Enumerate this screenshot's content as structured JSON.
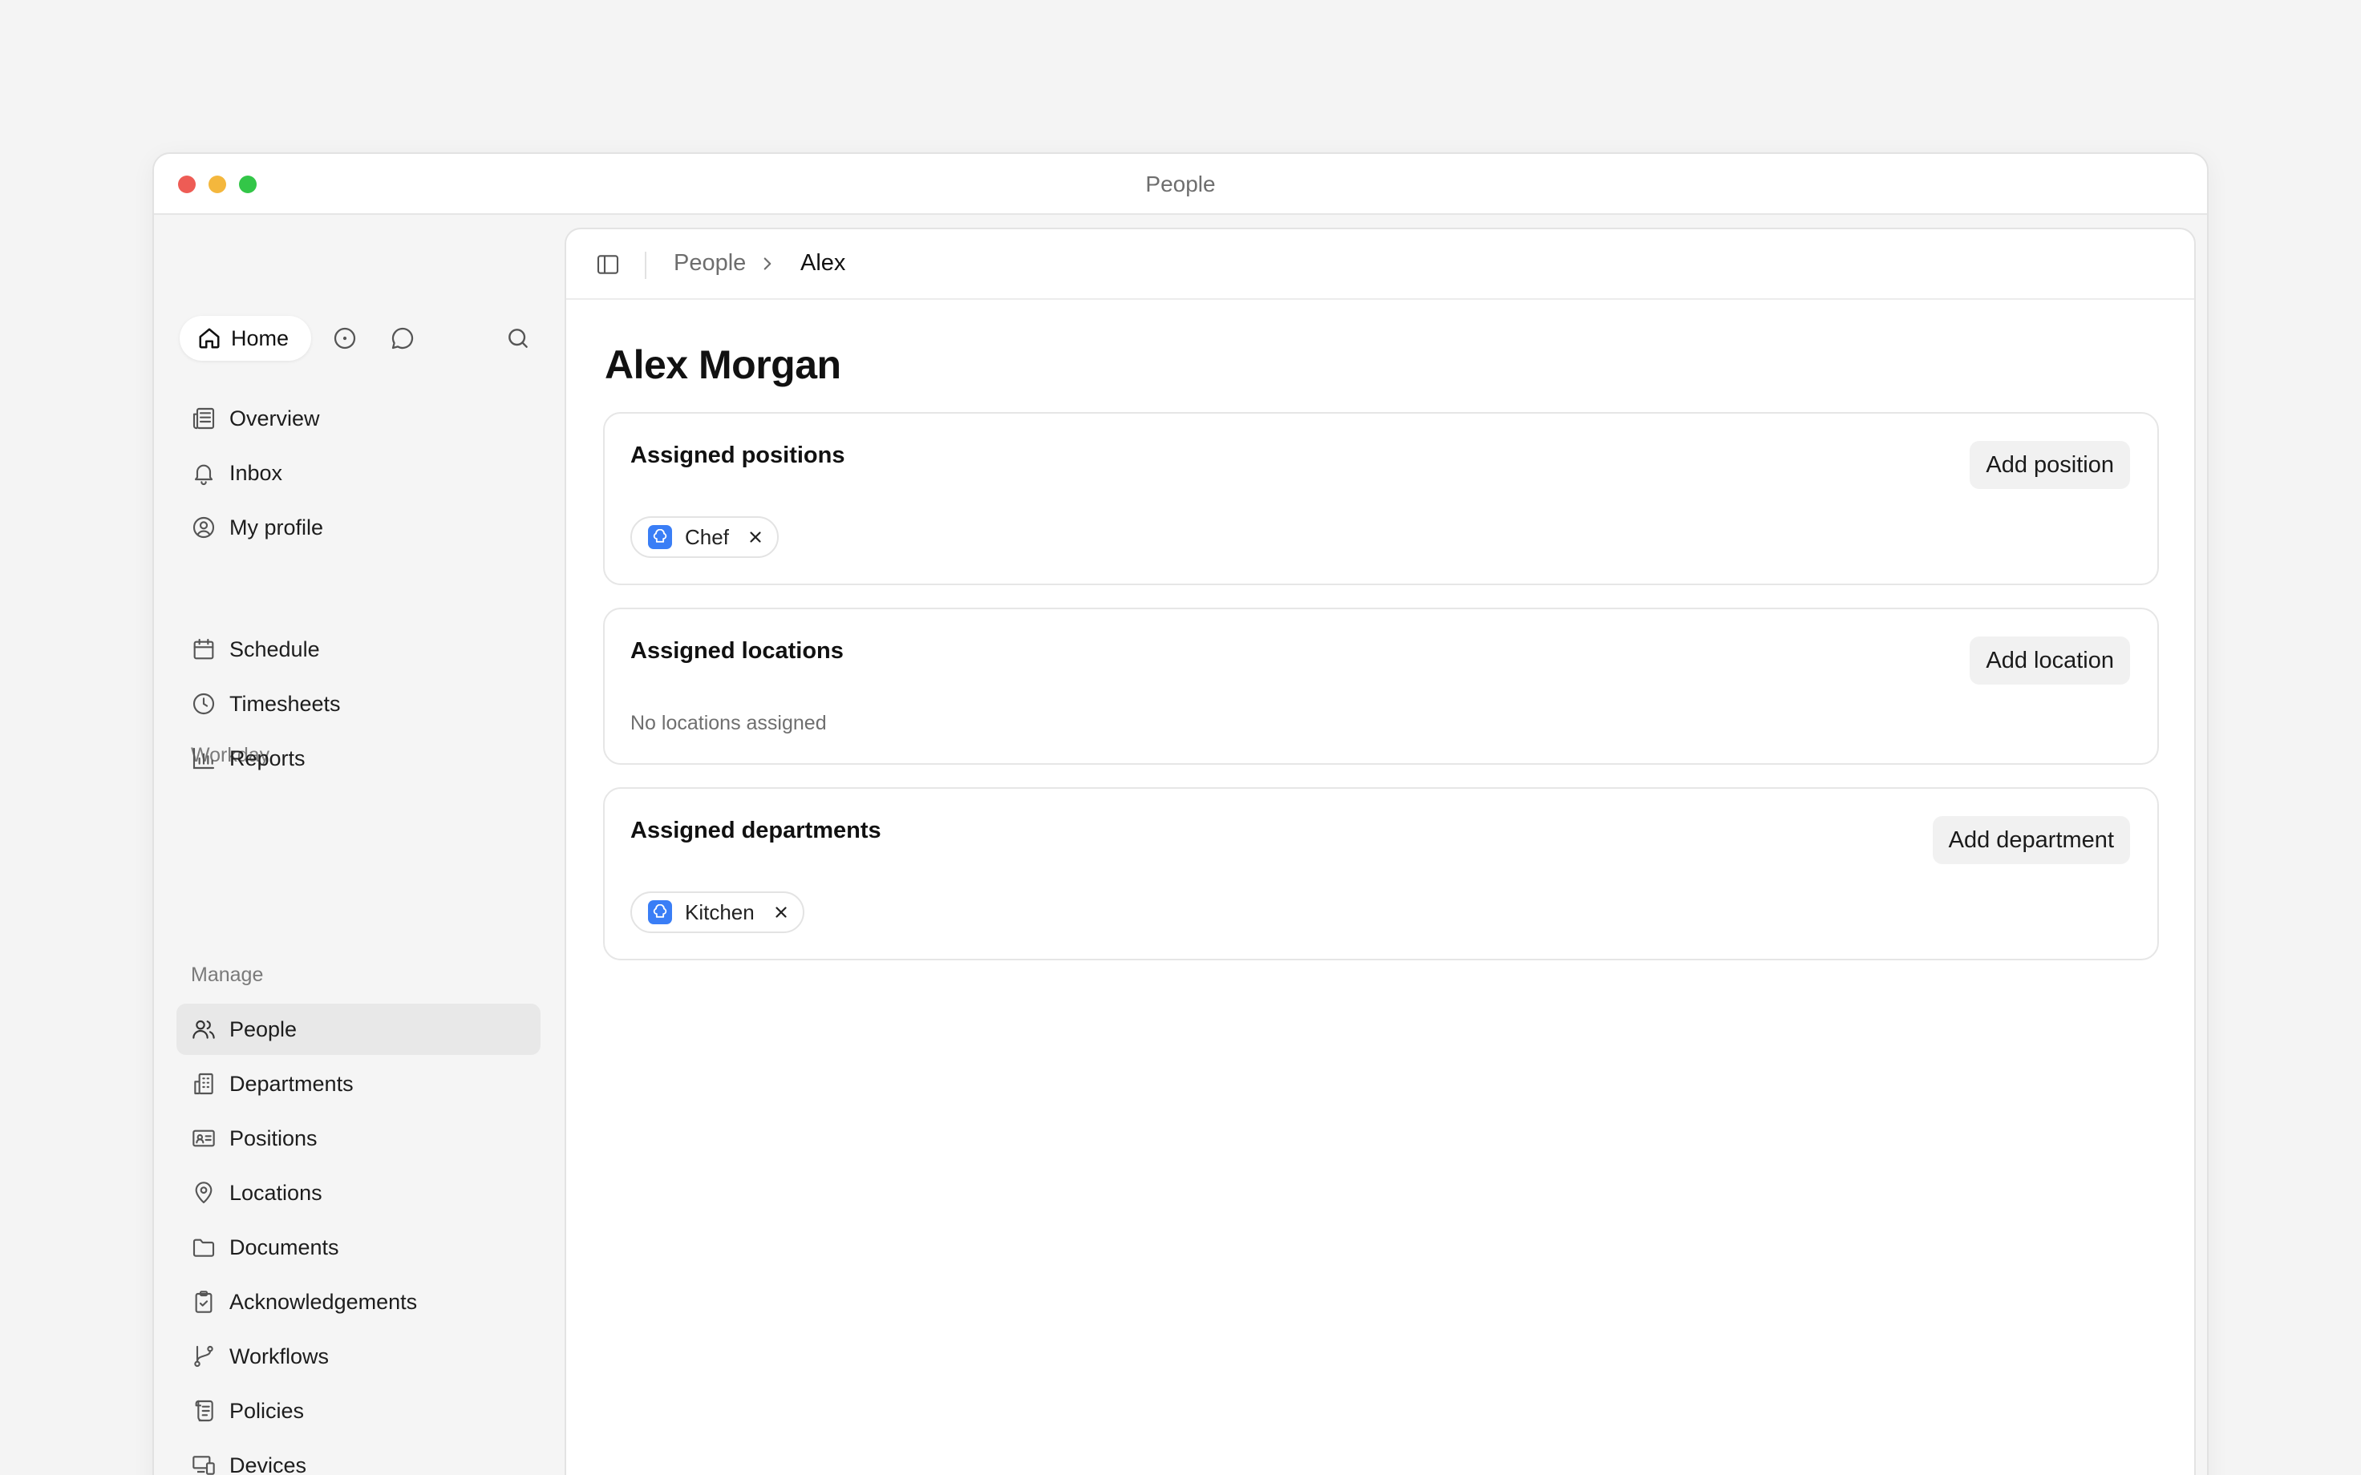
{
  "window": {
    "title": "People"
  },
  "sidebar": {
    "home_label": "Home",
    "primary": [
      {
        "id": "overview",
        "label": "Overview",
        "icon": "newspaper-icon"
      },
      {
        "id": "inbox",
        "label": "Inbox",
        "icon": "bell-icon"
      },
      {
        "id": "my-profile",
        "label": "My profile",
        "icon": "user-circle-icon"
      }
    ],
    "workday_label": "Workday",
    "workday": [
      {
        "id": "schedule",
        "label": "Schedule",
        "icon": "calendar-icon"
      },
      {
        "id": "timesheets",
        "label": "Timesheets",
        "icon": "clock-icon"
      },
      {
        "id": "reports",
        "label": "Reports",
        "icon": "bar-chart-icon"
      }
    ],
    "manage_label": "Manage",
    "manage": [
      {
        "id": "people",
        "label": "People",
        "icon": "users-icon",
        "active": true
      },
      {
        "id": "departments",
        "label": "Departments",
        "icon": "building-icon"
      },
      {
        "id": "positions",
        "label": "Positions",
        "icon": "id-card-icon"
      },
      {
        "id": "locations",
        "label": "Locations",
        "icon": "map-pin-icon"
      },
      {
        "id": "documents",
        "label": "Documents",
        "icon": "folder-icon"
      },
      {
        "id": "acknowledgements",
        "label": "Acknowledgements",
        "icon": "clipboard-check-icon"
      },
      {
        "id": "workflows",
        "label": "Workflows",
        "icon": "git-branch-icon"
      },
      {
        "id": "policies",
        "label": "Policies",
        "icon": "scroll-icon"
      },
      {
        "id": "devices",
        "label": "Devices",
        "icon": "devices-icon"
      }
    ]
  },
  "breadcrumb": {
    "parent": "People",
    "current": "Alex"
  },
  "person": {
    "name": "Alex Morgan"
  },
  "positions": {
    "title": "Assigned positions",
    "button": "Add position",
    "items": [
      {
        "label": "Chef",
        "icon": "chef-hat-icon"
      }
    ]
  },
  "locations": {
    "title": "Assigned locations",
    "button": "Add location",
    "empty": "No locations assigned"
  },
  "departments": {
    "title": "Assigned departments",
    "button": "Add department",
    "items": [
      {
        "label": "Kitchen",
        "icon": "chef-hat-icon"
      }
    ]
  },
  "colors": {
    "accent": "#3a7ef6",
    "active_bg": "#e8e8e8"
  }
}
